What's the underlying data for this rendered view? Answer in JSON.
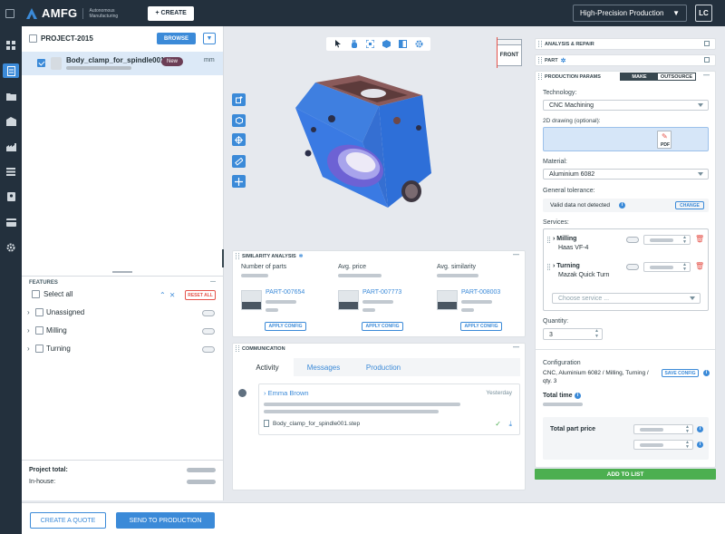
{
  "app": {
    "logo": "AMFG",
    "logo_sub": "Autonomous Manufacturing",
    "create_label": "+ CREATE",
    "process": "High-Precision Production",
    "user_initials": "LC",
    "accent": "#3b8ad8",
    "topbar_color": "#23303d"
  },
  "nav": {
    "icons": [
      "dashboard-icon",
      "orders-icon",
      "folder-icon",
      "factory-icon",
      "production-icon",
      "list-icon",
      "contacts-icon",
      "billing-icon",
      "settings-icon"
    ],
    "active_index": 1
  },
  "project": {
    "name": "PROJECT-2015",
    "browse_label": "BROWSE",
    "part": {
      "name": "Body_clamp_for_spindle001",
      "badge": "New",
      "unit": "mm"
    }
  },
  "features": {
    "title": "FEATURES",
    "select_all": "Select all",
    "reset_label": "RESET ALL",
    "items": [
      {
        "label": "Unassigned"
      },
      {
        "label": "Milling"
      },
      {
        "label": "Turning"
      }
    ]
  },
  "totals": {
    "project_total": "Project total:",
    "in_house": "In-house:"
  },
  "bottom": {
    "quote_label": "CREATE A QUOTE",
    "send_label": "SEND TO PRODUCTION"
  },
  "viewer": {
    "view_cube_label": "FRONT",
    "toolbar_icons": [
      "pointer-icon",
      "pan-hand-icon",
      "fit-view-icon",
      "cube-view-icon",
      "section-icon",
      "settings-icon"
    ],
    "side_tools": [
      "add-face-icon",
      "box-icon",
      "target-icon",
      "measure-icon",
      "axis-icon"
    ]
  },
  "similarity": {
    "title": "SIMILARITY ANALYSIS",
    "columns": [
      "Number of parts",
      "Avg. price",
      "Avg. similarity"
    ],
    "parts": [
      {
        "id": "PART-007654",
        "apply": "APPLY CONFIG"
      },
      {
        "id": "PART-007773",
        "apply": "APPLY CONFIG"
      },
      {
        "id": "PART-008003",
        "apply": "APPLY CONFIG"
      }
    ]
  },
  "communication": {
    "title": "COMMUNICATION",
    "tabs": [
      "Activity",
      "Messages",
      "Production"
    ],
    "activity": {
      "author": "Emma Brown",
      "time": "Yesterday",
      "file": "Body_clamp_for_spindle001.step"
    }
  },
  "right": {
    "analysis_title": "ANALYSIS & REPAIR",
    "part_title": "PART",
    "params_title": "PRODUCTION PARAMS",
    "make_label": "MAKE",
    "outsource_label": "OUTSOURCE",
    "technology_label": "Technology:",
    "technology_value": "CNC Machining",
    "drawing_label": "2D drawing (optional):",
    "pdf_label": "PDF",
    "material_label": "Material:",
    "material_value": "Aluminium 6082",
    "tolerance_label": "General tolerance:",
    "tolerance_value": "Valid data not detected",
    "change_label": "CHANGE",
    "services_label": "Services:",
    "services": [
      {
        "name": "Milling",
        "machine": "Haas VF-4"
      },
      {
        "name": "Turning",
        "machine": "Mazak Quick Turn"
      }
    ],
    "choose_service": "Choose service ...",
    "quantity_label": "Quantity:",
    "quantity_value": "3",
    "config_label": "Configuration",
    "config_value": "CNC, Aluminium 6082 / Milling, Turning / qty. 3",
    "save_config": "SAVE CONFIG",
    "total_time": "Total time",
    "total_price": "Total part price",
    "add_label": "ADD TO LIST"
  }
}
